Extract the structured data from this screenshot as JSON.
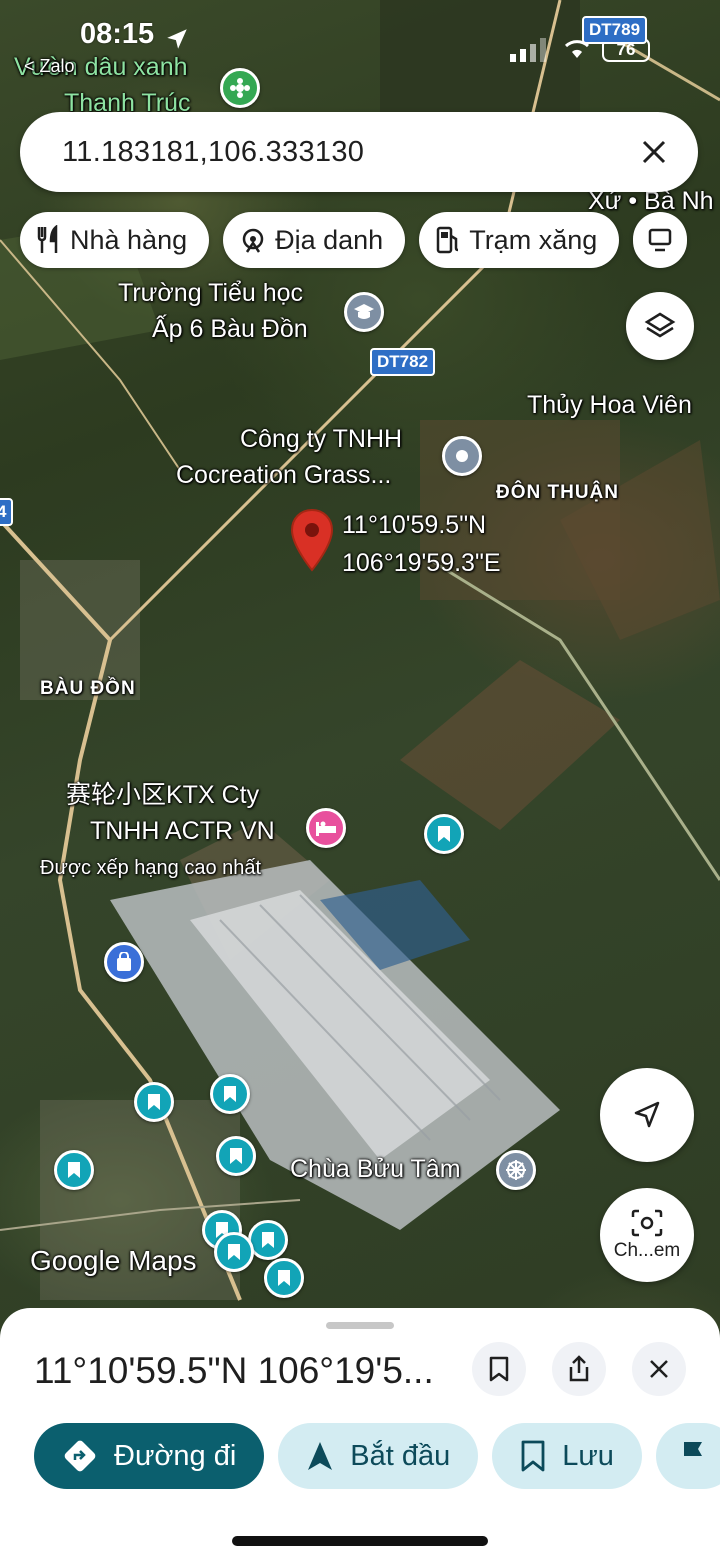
{
  "status_bar": {
    "time": "08:15",
    "battery": "76"
  },
  "map": {
    "labels": {
      "vuon": "Vườn dâu xanh",
      "vuon2": "Thanh Trúc",
      "xa": "Xứ • Bà Nh",
      "zalo": "< Zalo",
      "truong1": "Trường Tiểu học",
      "truong2": "Ấp 6 Bàu Đồn",
      "thuy": "Thủy Hoa Viên",
      "congty1": "Công ty TNHH",
      "congty2": "Cocreation Grass...",
      "donthuan": "ĐÔN THUẬN",
      "coord1": "11°10'59.5\"N",
      "coord2": "106°19'59.3\"E",
      "baudon": "BÀU ĐỒN",
      "ktx1": "赛轮小区KTX Cty",
      "ktx2": "TNHH ACTR VN",
      "ktx3": "Được xếp hạng cao nhất",
      "chua": "Chùa Bửu Tâm",
      "google": "Google Maps",
      "partial_left": "4"
    },
    "roads": {
      "dt782": "DT782",
      "dt789": "DT789"
    }
  },
  "search": {
    "value": "11.183181,106.333130"
  },
  "chips": [
    {
      "label": "Nhà hàng",
      "icon": "fork-knife-icon"
    },
    {
      "label": "Địa danh",
      "icon": "landmark-icon"
    },
    {
      "label": "Trạm xăng",
      "icon": "gas-station-icon"
    }
  ],
  "camera_fab": {
    "label": "Ch...em"
  },
  "sheet": {
    "title": "11°10'59.5\"N 106°19'5...",
    "actions": [
      {
        "label": "Đường đi",
        "icon": "directions-icon"
      },
      {
        "label": "Bắt đầu",
        "icon": "navigation-arrow-icon"
      },
      {
        "label": "Lưu",
        "icon": "bookmark-icon"
      }
    ]
  },
  "colors": {
    "primary": "#0b5f6e",
    "tonal": "#d3ecf2",
    "pin_red": "#d93025",
    "teal_pin": "#12a4b7"
  }
}
